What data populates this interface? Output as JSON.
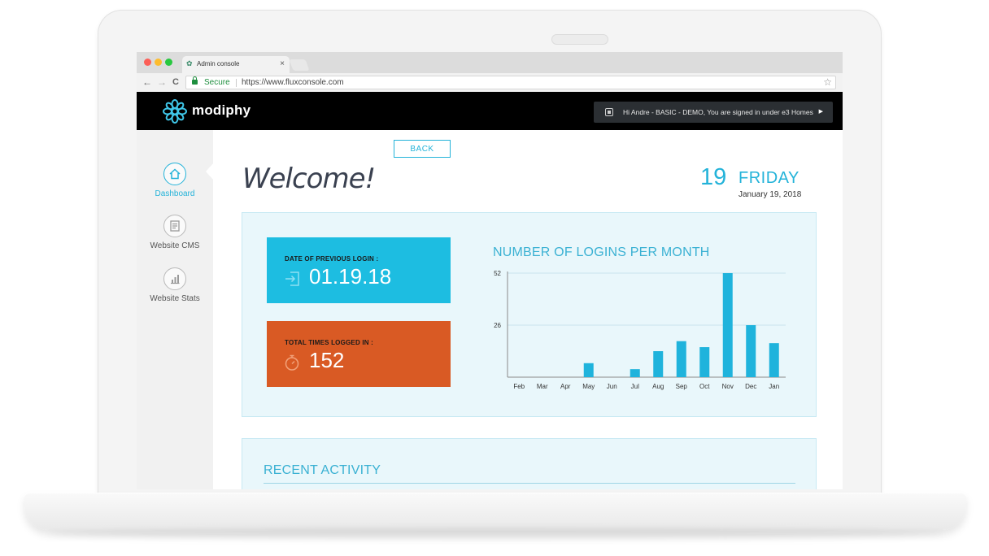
{
  "browser": {
    "tab_title": "Admin console",
    "tab_close": "×",
    "secure_label": "Secure",
    "url": "https://www.fluxconsole.com",
    "nav_back": "←",
    "nav_forward": "→",
    "nav_reload": "C",
    "star": "☆"
  },
  "header": {
    "logo_text": "modiphy",
    "user_greeting": "Hi Andre - BASIC - DEMO, You are signed in under e3 Homes",
    "user_caret": "▶"
  },
  "sidebar": {
    "items": [
      {
        "label": "Dashboard",
        "icon": "home-icon",
        "active": true
      },
      {
        "label": "Website CMS",
        "icon": "document-icon",
        "active": false
      },
      {
        "label": "Website Stats",
        "icon": "bar-chart-icon",
        "active": false
      }
    ]
  },
  "main": {
    "back_label": "BACK",
    "welcome": "Welcome!",
    "date_day": "19",
    "date_weekday": "FRIDAY",
    "date_full": "January 19, 2018"
  },
  "stats": {
    "previous_login_label": "DATE OF PREVIOUS LOGIN :",
    "previous_login_value": "01.19.18",
    "total_logins_label": "TOTAL TIMES LOGGED IN :",
    "total_logins_value": "152"
  },
  "chart_data": {
    "type": "bar",
    "title": "NUMBER OF LOGINS PER MONTH",
    "categories": [
      "Feb",
      "Mar",
      "Apr",
      "May",
      "Jun",
      "Jul",
      "Aug",
      "Sep",
      "Oct",
      "Nov",
      "Dec",
      "Jan"
    ],
    "values": [
      0,
      0,
      0,
      7,
      0,
      4,
      13,
      18,
      15,
      52,
      26,
      17
    ],
    "yticks": [
      26,
      52
    ],
    "ylim": [
      0,
      52
    ],
    "grid": true,
    "color": "#1fb3dc"
  },
  "activity": {
    "title": "RECENT ACTIVITY"
  },
  "colors": {
    "accent": "#24b3d9",
    "login_card": "#1dbde1",
    "total_card": "#d95a24",
    "header_bg": "#000000"
  }
}
